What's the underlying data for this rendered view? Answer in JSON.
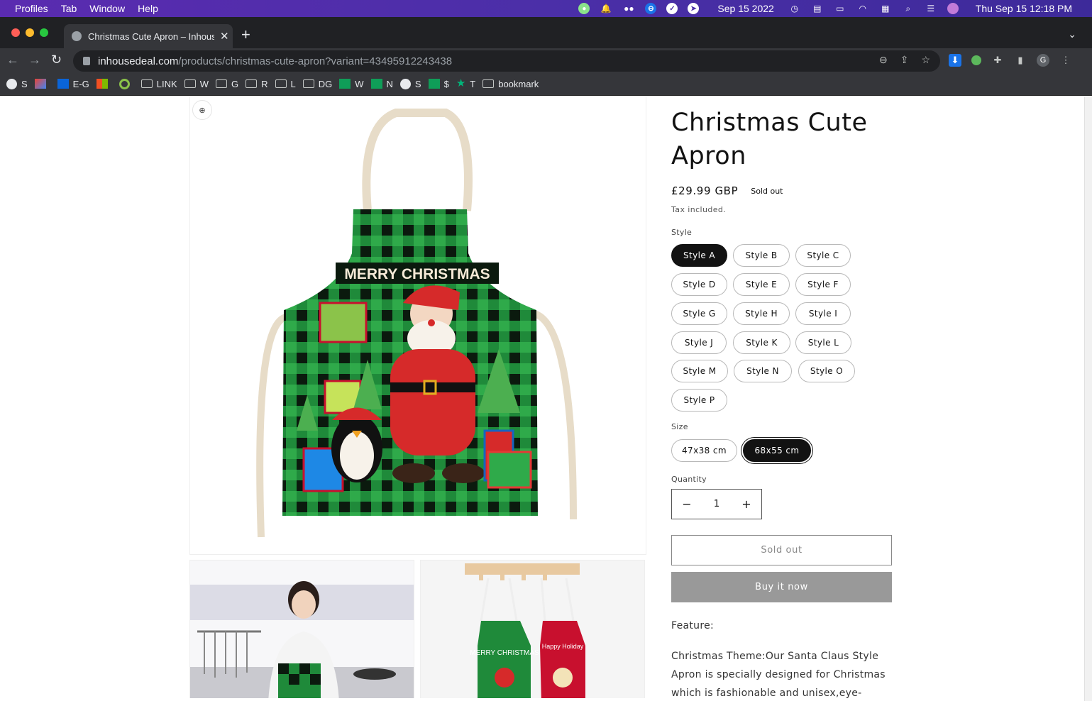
{
  "menubar": {
    "items": [
      "Profiles",
      "Tab",
      "Window",
      "Help"
    ],
    "date_short": "Sep 15 2022",
    "clock": "Thu Sep 15  12:18 PM"
  },
  "tab": {
    "title": "Christmas Cute Apron – Inhous",
    "close": "✕"
  },
  "toolbar": {
    "url_host": "inhousedeal.com",
    "url_path": "/products/christmas-cute-apron?variant=43495912243438",
    "profile_initial": "G"
  },
  "bookmarks": [
    {
      "label": "S",
      "icon": "globe-icon"
    },
    {
      "label": "",
      "icon": "gmail-icon"
    },
    {
      "label": "E-G",
      "icon": "outlook-icon"
    },
    {
      "label": "",
      "icon": "microsoft-icon"
    },
    {
      "label": "",
      "icon": "g-icon"
    },
    {
      "label": "LINK",
      "icon": "folder-icon"
    },
    {
      "label": "W",
      "icon": "folder-icon"
    },
    {
      "label": "G",
      "icon": "folder-icon"
    },
    {
      "label": "R",
      "icon": "folder-icon"
    },
    {
      "label": "L",
      "icon": "folder-icon"
    },
    {
      "label": "DG",
      "icon": "folder-icon"
    },
    {
      "label": "W",
      "icon": "plus-icon"
    },
    {
      "label": "N",
      "icon": "plus-icon"
    },
    {
      "label": "S",
      "icon": "globe-icon"
    },
    {
      "label": "$",
      "icon": "plus-icon"
    },
    {
      "label": "T",
      "icon": "star-icon"
    },
    {
      "label": "bookmark",
      "icon": "folder-icon"
    }
  ],
  "product": {
    "title": "Christmas Cute Apron",
    "price": "£29.99 GBP",
    "badge": "Sold out",
    "tax_note": "Tax included.",
    "style_label": "Style",
    "styles": [
      "Style A",
      "Style B",
      "Style C",
      "Style D",
      "Style E",
      "Style F",
      "Style G",
      "Style H",
      "Style I",
      "Style J",
      "Style K",
      "Style L",
      "Style M",
      "Style N",
      "Style O",
      "Style P"
    ],
    "selected_style": "Style A",
    "size_label": "Size",
    "sizes": [
      "47x38 cm",
      "68x55 cm"
    ],
    "selected_size": "68x55 cm",
    "quantity_label": "Quantity",
    "quantity": "1",
    "minus": "−",
    "plus": "+",
    "soldout_button": "Sold out",
    "buy_button": "Buy it now",
    "feature_heading": "Feature:",
    "description": "Christmas Theme:Our Santa Claus Style Apron is specially designed for Christmas which is fashionable and unisex,eye-catching decoration"
  },
  "media": {
    "main_apron_text": "MERRY CHRISTMAS",
    "thumb_apron_text": "MERRY CHRISTMAS",
    "thumb_apron_text_2": "Happy Holiday"
  },
  "colors": {
    "menubar": "#4b2fa8",
    "chrome_dark": "#202124",
    "chrome_toolbar": "#35363a",
    "accent_black": "#121212",
    "disabled_gray": "#999999"
  }
}
